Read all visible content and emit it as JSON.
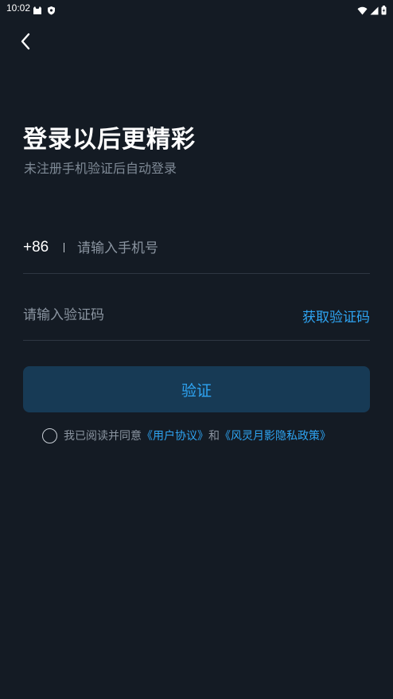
{
  "status_bar": {
    "time": "10:02",
    "left_icons": [
      "cat-icon",
      "shield-icon"
    ],
    "right_icons": [
      "wifi-icon",
      "signal-icon",
      "battery-icon"
    ]
  },
  "header": {
    "back_icon": "chevron-left-icon"
  },
  "title": "登录以后更精彩",
  "subtitle": "未注册手机验证后自动登录",
  "phone": {
    "country_code": "+86",
    "placeholder": "请输入手机号",
    "value": ""
  },
  "code": {
    "placeholder": "请输入验证码",
    "value": "",
    "get_code_label": "获取验证码"
  },
  "verify_button_label": "验证",
  "agreement": {
    "checked": false,
    "prefix": "我已阅读并同意",
    "user_agreement": "《用户协议》",
    "conjunction": "和",
    "privacy_policy": "《风灵月影隐私政策》"
  },
  "colors": {
    "background": "#141b24",
    "accent": "#2ea4f2",
    "button_bg": "#173a55",
    "muted_text": "#8a94a0"
  }
}
